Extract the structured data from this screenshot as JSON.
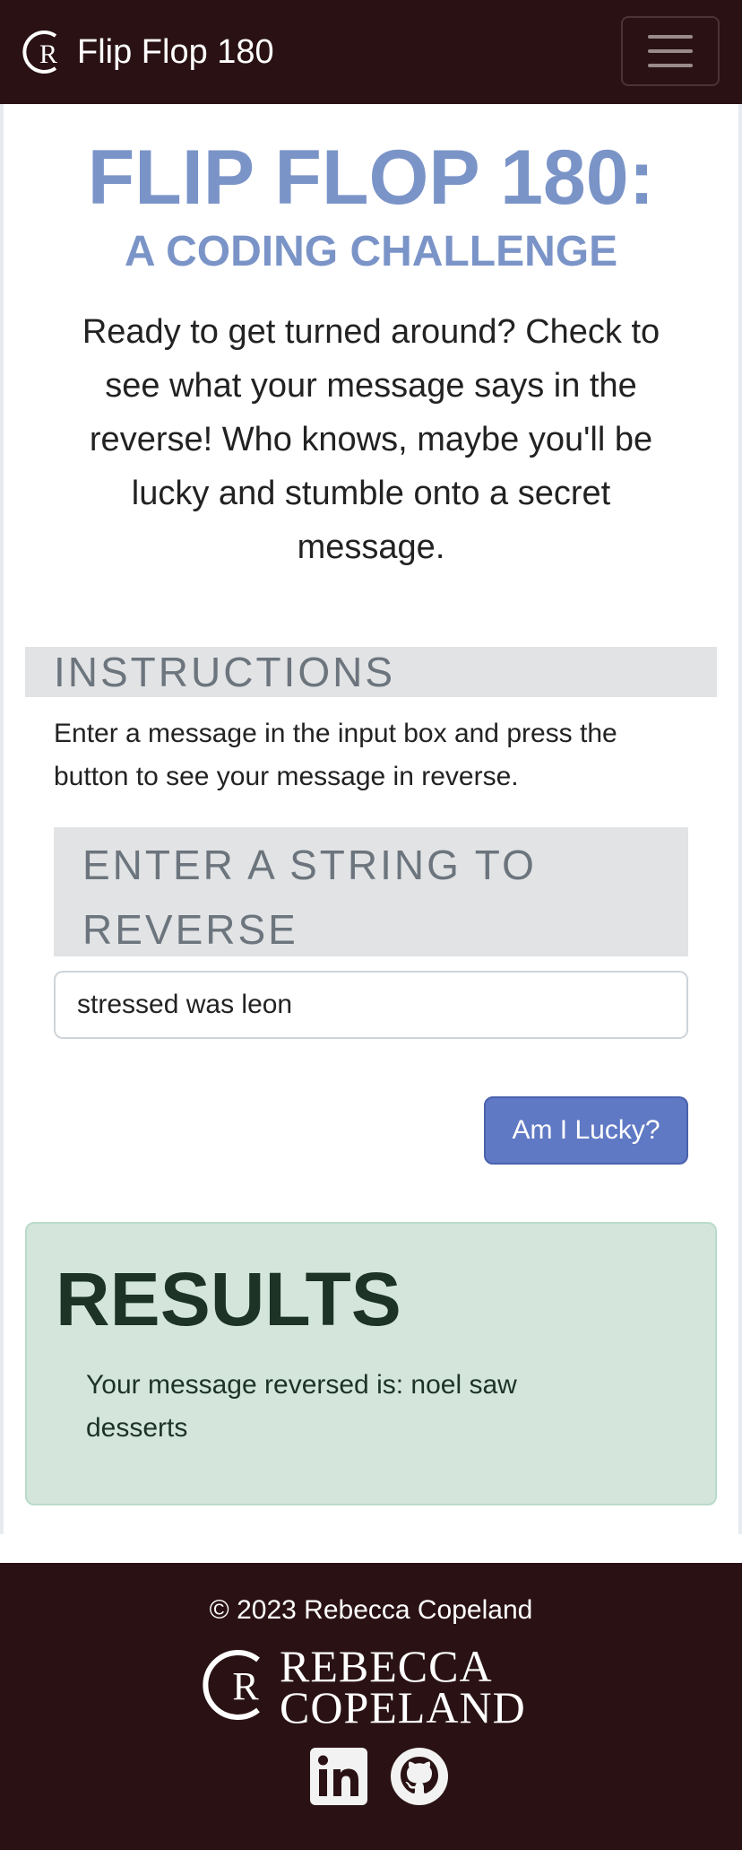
{
  "navbar": {
    "brand_text": "Flip Flop 180",
    "logo_letter": "R"
  },
  "main": {
    "title": "FLIP FLOP 180:",
    "subtitle": "A CODING CHALLENGE",
    "intro": "Ready to get turned around? Check to see what your message says in the reverse! Who knows, maybe you'll be lucky and stumble onto a secret message.",
    "instructions_heading": "INSTRUCTIONS",
    "instructions_text": "Enter a message in the input box and press the button to see your message in reverse.",
    "input_label": "ENTER A STRING TO REVERSE",
    "input_value": "stressed was leon",
    "button_label": "Am I Lucky?"
  },
  "results": {
    "heading": "RESULTS",
    "text": "Your message reversed is: noel saw desserts"
  },
  "footer": {
    "copyright": "© 2023 Rebecca Copeland",
    "logo_line1": "REBECCA",
    "logo_line2": "COPELAND",
    "logo_letter": "R",
    "social": [
      "linkedin-icon",
      "github-icon"
    ]
  },
  "colors": {
    "nav_bg": "#2a1214",
    "title": "#7b94c8",
    "button": "#6079c4",
    "results_bg": "#d4e6dc"
  }
}
